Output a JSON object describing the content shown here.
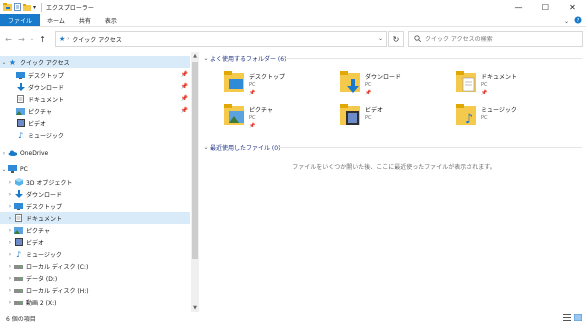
{
  "window": {
    "title": "エクスプローラー",
    "controls": {
      "minimize": "—",
      "maximize": "☐",
      "close": "✕"
    }
  },
  "ribbon": {
    "tabs": [
      "ファイル",
      "ホーム",
      "共有",
      "表示"
    ]
  },
  "address": {
    "crumb": "クイック アクセス",
    "search_placeholder": "クイック アクセスの検索"
  },
  "nav": {
    "quick_access": "クイック アクセス",
    "quick_items": [
      {
        "label": "デスクトップ",
        "icon": "desktop-icon",
        "pinned": true
      },
      {
        "label": "ダウンロード",
        "icon": "download-icon",
        "pinned": true
      },
      {
        "label": "ドキュメント",
        "icon": "document-icon",
        "pinned": true
      },
      {
        "label": "ピクチャ",
        "icon": "picture-icon",
        "pinned": true
      },
      {
        "label": "ビデオ",
        "icon": "video-icon",
        "pinned": false
      },
      {
        "label": "ミュージック",
        "icon": "music-icon",
        "pinned": false
      }
    ],
    "onedrive": "OneDrive",
    "pc": "PC",
    "pc_items": [
      {
        "label": "3D オブジェクト",
        "icon": "3d-objects-icon"
      },
      {
        "label": "ダウンロード",
        "icon": "download-icon"
      },
      {
        "label": "デスクトップ",
        "icon": "desktop-icon"
      },
      {
        "label": "ドキュメント",
        "icon": "document-icon",
        "selected": true
      },
      {
        "label": "ピクチャ",
        "icon": "picture-icon"
      },
      {
        "label": "ビデオ",
        "icon": "video-icon"
      },
      {
        "label": "ミュージック",
        "icon": "music-icon"
      },
      {
        "label": "ローカル ディスク (C:)",
        "icon": "drive-icon"
      },
      {
        "label": "データ (D:)",
        "icon": "drive-icon"
      },
      {
        "label": "ローカル ディスク (H:)",
        "icon": "drive-icon"
      },
      {
        "label": "動画 2 (X:)",
        "icon": "drive-icon"
      }
    ]
  },
  "main": {
    "frequent_header": "よく使用するフォルダー (6)",
    "folders": [
      {
        "name": "デスクトップ",
        "sub": "PC",
        "pinned": true,
        "icon": "desktop-folder-icon"
      },
      {
        "name": "ダウンロード",
        "sub": "PC",
        "pinned": true,
        "icon": "download-folder-icon"
      },
      {
        "name": "ドキュメント",
        "sub": "PC",
        "pinned": true,
        "icon": "document-folder-icon"
      },
      {
        "name": "ピクチャ",
        "sub": "PC",
        "pinned": true,
        "icon": "picture-folder-icon"
      },
      {
        "name": "ビデオ",
        "sub": "PC",
        "pinned": false,
        "icon": "video-folder-icon"
      },
      {
        "name": "ミュージック",
        "sub": "PC",
        "pinned": false,
        "icon": "music-folder-icon"
      }
    ],
    "recent_header": "最近使用したファイル (0)",
    "empty_message": "ファイルをいくつか開いた後、ここに最近使ったファイルが表示されます。"
  },
  "status": {
    "count": "6 個の項目"
  },
  "colors": {
    "accent": "#1979ca",
    "selection": "#d9ebf9",
    "folder": "#f5c94c",
    "header_text": "#1e3287"
  }
}
